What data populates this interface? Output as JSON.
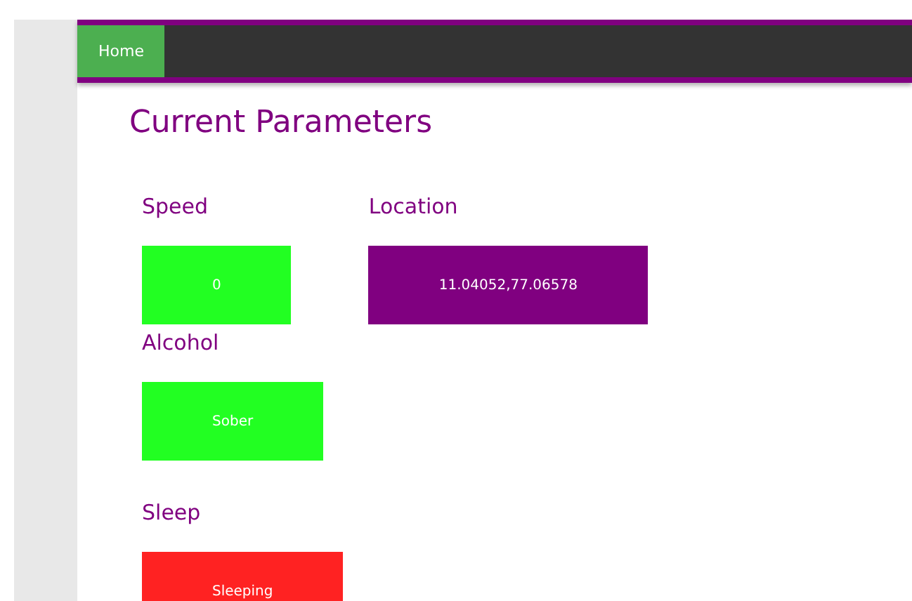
{
  "nav": {
    "items": [
      {
        "label": "Home",
        "selected": true
      }
    ]
  },
  "title": "Current Parameters",
  "rows": [
    {
      "items": [
        {
          "label": "Speed",
          "value": "0",
          "color": "#22ff22"
        },
        {
          "label": "Location",
          "value": "11.04052,77.06578",
          "color": "#800080"
        }
      ]
    },
    {
      "items": [
        {
          "label": "Alcohol",
          "value": "Sober",
          "color": "#22ff22"
        }
      ]
    },
    {
      "items": [
        {
          "label": "Sleep",
          "value": "Sleeping",
          "color": "#ff2222"
        }
      ]
    }
  ]
}
